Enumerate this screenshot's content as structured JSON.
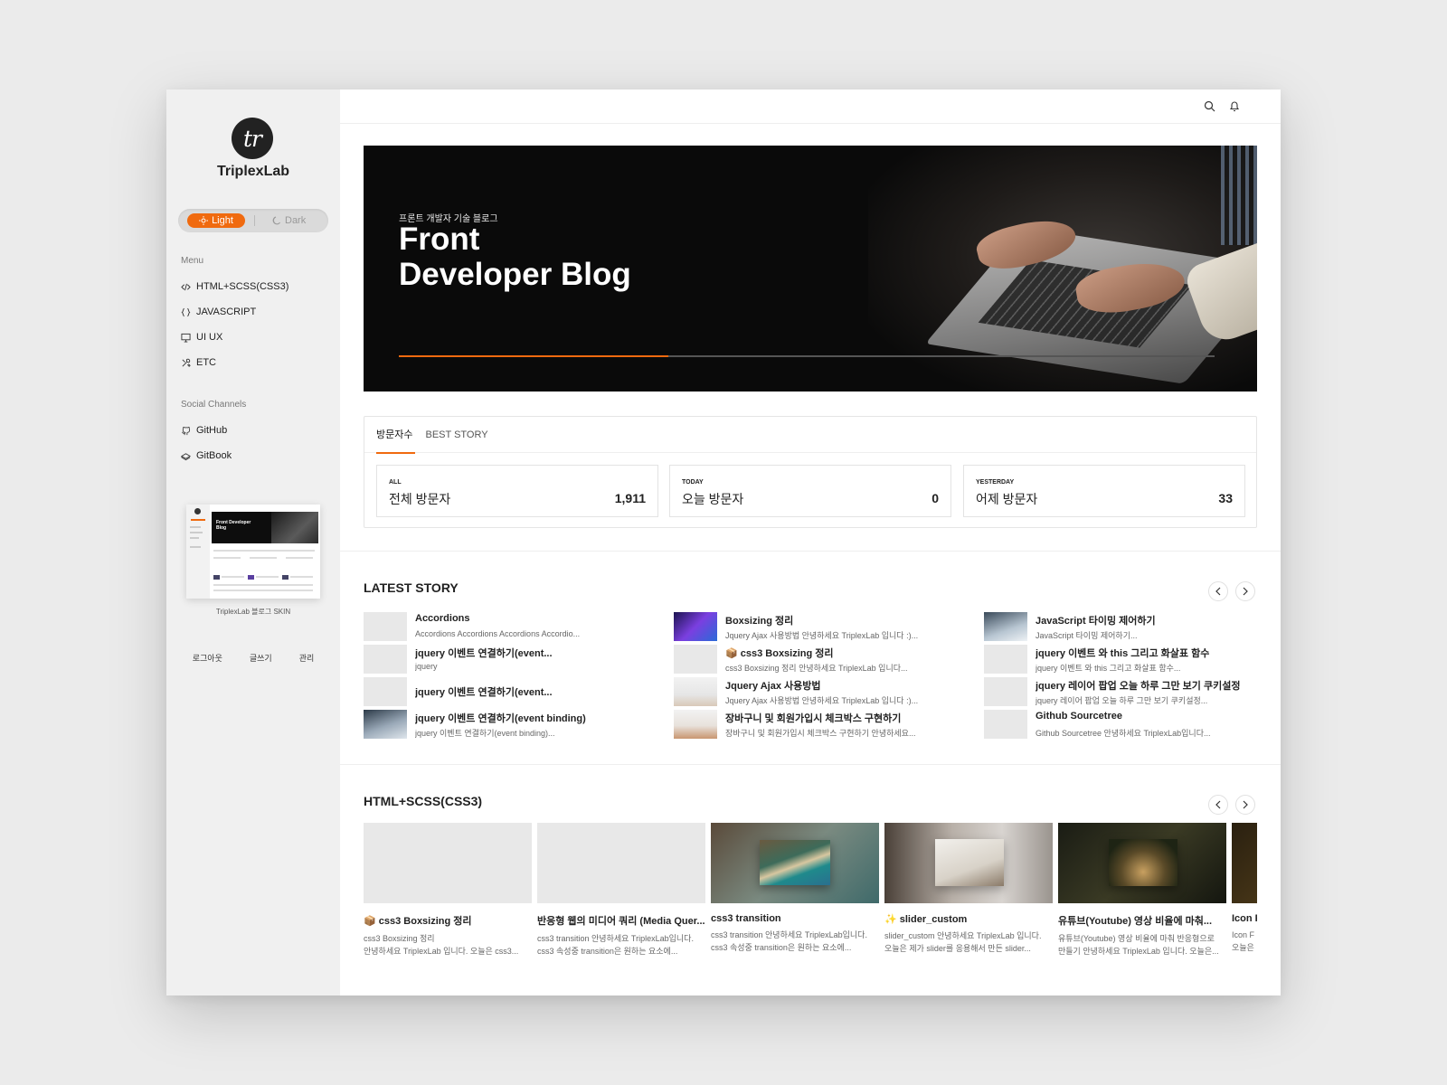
{
  "brand": {
    "logo_text": "tr",
    "name": "TriplexLab"
  },
  "theme_toggle": {
    "light": "Light",
    "dark": "Dark"
  },
  "sidebar": {
    "menu_title": "Menu",
    "menu": [
      {
        "icon": "code-icon",
        "label": "HTML+SCSS(CSS3)"
      },
      {
        "icon": "braces-icon",
        "label": "JAVASCRIPT"
      },
      {
        "icon": "monitor-icon",
        "label": "UI UX"
      },
      {
        "icon": "tools-icon",
        "label": "ETC"
      }
    ],
    "social_title": "Social Channels",
    "social": [
      {
        "icon": "github-icon",
        "label": "GitHub"
      },
      {
        "icon": "gitbook-icon",
        "label": "GitBook"
      }
    ],
    "preview_title": "Front Developer Blog",
    "preview_caption": "TriplexLab 블로그 SKIN",
    "footer_links": [
      "로그아웃",
      "글쓰기",
      "관리"
    ]
  },
  "hero": {
    "subtitle": "프론트 개발자 기술 블로그",
    "title": "Front Developer Blog",
    "progress": 0.33
  },
  "visitor": {
    "tabs": [
      "방문자수",
      "BEST STORY"
    ],
    "active_tab": 0,
    "stats": [
      {
        "label": "ALL",
        "title": "전체 방문자",
        "value": "1,911"
      },
      {
        "label": "TODAY",
        "title": "오늘 방문자",
        "value": "0"
      },
      {
        "label": "YESTERDAY",
        "title": "어제 방문자",
        "value": "33"
      }
    ]
  },
  "latest": {
    "heading": "LATEST STORY",
    "columns": [
      [
        {
          "title": "Accordions",
          "desc": "Accordions Accordions Accordions Accordio..."
        },
        {
          "title": "jquery 이벤트 연결하기(event...",
          "desc": "jquery"
        },
        {
          "title": "jquery 이벤트 연결하기(event...",
          "desc": ""
        },
        {
          "title": "jquery 이벤트 연결하기(event binding)",
          "desc": "jquery 이벤트 연결하기(event binding)..."
        }
      ],
      [
        {
          "title": "Boxsizing 정리",
          "desc": "Jquery Ajax 사용방법 안녕하세요 TriplexLab 입니다 :)..."
        },
        {
          "title": "📦 css3 Boxsizing 정리",
          "desc": "css3 Boxsizing 정리 안녕하세요 TriplexLab 입니다..."
        },
        {
          "title": "Jquery Ajax 사용방법",
          "desc": "Jquery Ajax 사용방법 안녕하세요 TriplexLab 입니다 :)..."
        },
        {
          "title": "장바구니 및 회원가입시 체크박스 구현하기",
          "desc": "장바구니 및 회원가입시 체크박스 구현하기 안녕하세요..."
        }
      ],
      [
        {
          "title": "JavaScript 타이밍 제어하기",
          "desc": "JavaScript 타이밍 제어하기..."
        },
        {
          "title": "jquery 이벤트 와 this 그리고 화살표 함수",
          "desc": "jquery 이벤트 와 this 그리고 화살표 함수..."
        },
        {
          "title": "jquery 레이어 팝업 오늘 하루 그만 보기 쿠키설정",
          "desc": "jquery 레이어 팝업 오늘 하루 그만 보기 쿠키설정..."
        },
        {
          "title": "Github Sourcetree",
          "desc": "Github Sourcetree 안녕하세요 TriplexLab입니다..."
        }
      ]
    ]
  },
  "html_section": {
    "heading": "HTML+SCSS(CSS3)",
    "cards": [
      {
        "title": "📦 css3 Boxsizing 정리",
        "desc1": "css3 Boxsizing 정리",
        "desc2": "안녕하세요 TriplexLab 입니다. 오늘은 css3..."
      },
      {
        "title": "반응형 웹의 미디어 쿼리 (Media Quer...",
        "desc1": "css3 transition 안녕하세요 TriplexLab입니다.",
        "desc2": "css3 속성중 transition은 원하는 요소에..."
      },
      {
        "title": "css3 transition",
        "desc1": "css3 transition 안녕하세요 TriplexLab입니다.",
        "desc2": "css3 속성중 transition은 원하는 요소에..."
      },
      {
        "title": "✨ slider_custom",
        "desc1": "slider_custom 안녕하세요 TriplexLab 입니다.",
        "desc2": "오늘은 제가 slider를 응용해서 만든 slider..."
      },
      {
        "title": "유튜브(Youtube) 영상 비율에 마춰...",
        "desc1": "유튜브(Youtube) 영상 비율에 마춰 반응형으로",
        "desc2": "만들기 안녕하세요 TriplexLab 입니다. 오늘은..."
      },
      {
        "title": "Icon F",
        "desc1": "Icon F",
        "desc2": "오늘은 "
      }
    ]
  },
  "colors": {
    "accent": "#f06a0f",
    "sidebar_bg": "#f0f0f0",
    "hero_bg": "#0a0a0a"
  }
}
